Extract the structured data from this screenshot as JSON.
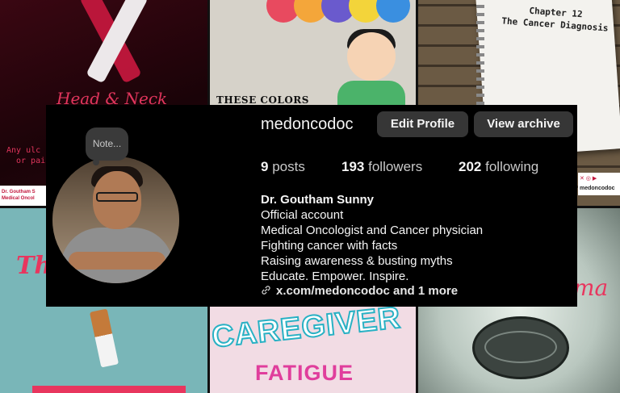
{
  "background_tiles": {
    "tile1": {
      "title": "Head & Neck",
      "side_text_1": "Any ulc",
      "side_text_2": "or pai",
      "strip_text_1": "Dr. Goutham S",
      "strip_text_2": "Medical Oncol"
    },
    "tile2": {
      "caption": "THESE COLORS"
    },
    "tile3": {
      "notebook_line_1": "Chapter 12",
      "notebook_line_2": "The Cancer Diagnosis",
      "handle": "medoncodoc"
    },
    "tile4": {
      "title": "The"
    },
    "tile5": {
      "title": "CAREGIVER",
      "subtitle": "FATIGUE"
    },
    "tile6": {
      "title": "ma"
    }
  },
  "profile": {
    "note": "Note...",
    "username": "medoncodoc",
    "edit_profile_label": "Edit Profile",
    "view_archive_label": "View archive",
    "stats": {
      "posts_count": "9",
      "posts_label": "posts",
      "followers_count": "193",
      "followers_label": "followers",
      "following_count": "202",
      "following_label": "following"
    },
    "bio": {
      "name": "Dr. Goutham Sunny",
      "lines": [
        "Official account",
        "Medical Oncologist and Cancer physician",
        "Fighting cancer with facts",
        "Raising awareness & busting myths",
        "Educate. Empower. Inspire."
      ],
      "link": "x.com/medoncodoc and 1 more"
    }
  },
  "colors": {
    "overlay_bg": "#000000",
    "button_bg": "#363636",
    "text_primary": "#f5f5f5",
    "text_secondary": "#c8c8c8"
  }
}
